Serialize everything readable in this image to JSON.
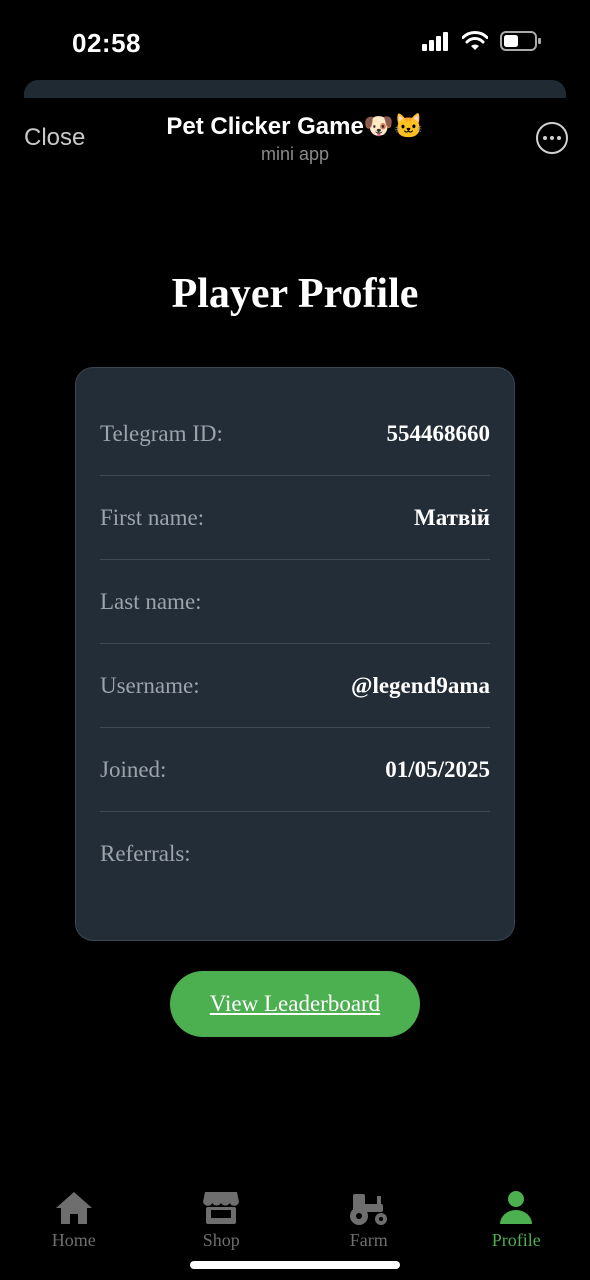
{
  "status_bar": {
    "time": "02:58"
  },
  "app_header": {
    "close_label": "Close",
    "title": "Pet Clicker Game🐶🐱",
    "subtitle": "mini app"
  },
  "page": {
    "title": "Player Profile"
  },
  "profile": {
    "rows": [
      {
        "label": "Telegram ID:",
        "value": "554468660"
      },
      {
        "label": "First name:",
        "value": "Матвій"
      },
      {
        "label": "Last name:",
        "value": ""
      },
      {
        "label": "Username:",
        "value": "@legend9ama"
      },
      {
        "label": "Joined:",
        "value": "01/05/2025"
      },
      {
        "label": "Referrals:",
        "value": ""
      }
    ]
  },
  "leaderboard_button": {
    "label": "View Leaderboard"
  },
  "bottom_nav": {
    "items": [
      {
        "label": "Home",
        "icon": "home-icon"
      },
      {
        "label": "Shop",
        "icon": "shop-icon"
      },
      {
        "label": "Farm",
        "icon": "tractor-icon"
      },
      {
        "label": "Profile",
        "icon": "user-icon"
      }
    ],
    "active": "Profile"
  },
  "colors": {
    "accent": "#4caf50",
    "card_bg": "#222d38",
    "background": "#000000"
  }
}
